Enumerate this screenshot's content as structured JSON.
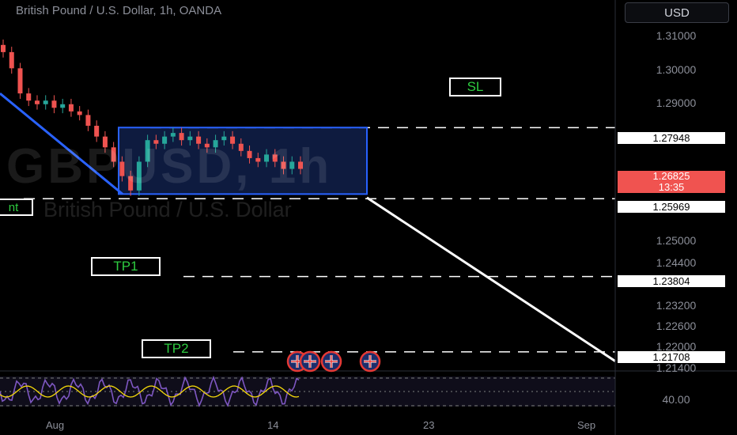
{
  "header": {
    "title": "British Pound / U.S. Dollar, 1h, OANDA",
    "currency": "USD"
  },
  "watermark": {
    "symbol": "GBPUSD, 1h",
    "name": "British Pound / U.S. Dollar"
  },
  "annotations": {
    "sl": "SL",
    "tp1": "TP1",
    "tp2": "TP2",
    "entry_fragment": "nt"
  },
  "price_axis": {
    "labels": [
      "1.31000",
      "1.30000",
      "1.29000",
      "1.25000",
      "1.24400",
      "1.23200",
      "1.22600",
      "1.22000",
      "1.21400"
    ],
    "levels": [
      {
        "name": "channel-top",
        "price": "1.27948"
      },
      {
        "name": "channel-bottom",
        "price": "1.25969"
      },
      {
        "name": "tp1-level",
        "price": "1.23804"
      },
      {
        "name": "tp2-level",
        "price": "1.21708"
      }
    ],
    "current_price": "1.26825",
    "countdown": "13:35"
  },
  "time_axis": [
    "Aug",
    "14",
    "23",
    "Sep"
  ],
  "oscillator": {
    "label": "40.00"
  },
  "chart_data": {
    "type": "line",
    "title": "British Pound / U.S. Dollar, 1h, OANDA",
    "ylim": [
      1.212,
      1.315
    ],
    "x_ticks": [
      "Aug",
      "14",
      "23",
      "Sep"
    ],
    "series": [
      {
        "values": [
          1.3005,
          1.296,
          1.289,
          1.287,
          1.286,
          1.287,
          1.285,
          1.286,
          1.284,
          1.283,
          1.28,
          1.277,
          1.274,
          1.27,
          1.266,
          1.262,
          1.27,
          1.276,
          1.275,
          1.277,
          1.278,
          1.276,
          1.277,
          1.275,
          1.274,
          1.276,
          1.277,
          1.275,
          1.273,
          1.271,
          1.27,
          1.272,
          1.27,
          1.268,
          1.27,
          1.268
        ]
      }
    ],
    "channel": {
      "upper": [
        1.2795,
        1.2795
      ],
      "lower": [
        1.261,
        1.261
      ]
    },
    "projection": [
      1.26,
      1.2145
    ],
    "levels": [
      1.27948,
      1.25969,
      1.23804,
      1.21708
    ],
    "grid": false
  }
}
